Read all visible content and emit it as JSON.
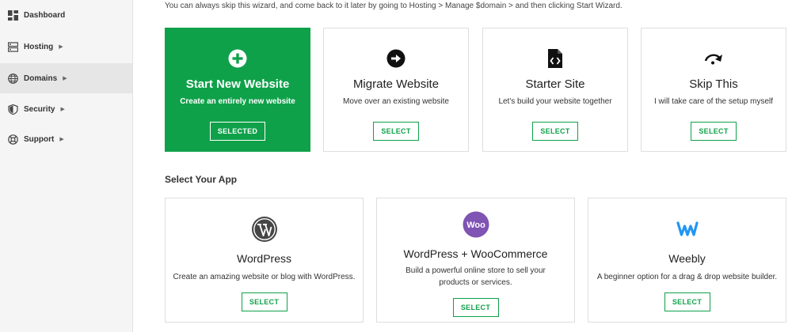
{
  "sidebar": {
    "items": [
      {
        "label": "Dashboard",
        "icon": "dashboard-icon",
        "has_chevron": false
      },
      {
        "label": "Hosting",
        "icon": "server-icon",
        "has_chevron": true
      },
      {
        "label": "Domains",
        "icon": "globe-icon",
        "has_chevron": true
      },
      {
        "label": "Security",
        "icon": "shield-icon",
        "has_chevron": true
      },
      {
        "label": "Support",
        "icon": "lifebuoy-icon",
        "has_chevron": true
      }
    ],
    "active_index": 2
  },
  "header": {
    "hint": "You can always skip this wizard, and come back to it later by going to Hosting > Manage $domain > and then clicking Start Wizard."
  },
  "options": [
    {
      "title": "Start New Website",
      "subtitle": "Create an entirely new website",
      "button": "SELECTED",
      "selected": true,
      "icon": "plus-circle-icon"
    },
    {
      "title": "Migrate Website",
      "subtitle": "Move over an existing website",
      "button": "SELECT",
      "selected": false,
      "icon": "arrow-right-circle-icon"
    },
    {
      "title": "Starter Site",
      "subtitle": "Let's build your website together",
      "button": "SELECT",
      "selected": false,
      "icon": "file-code-icon"
    },
    {
      "title": "Skip This",
      "subtitle": "I will take care of the setup myself",
      "button": "SELECT",
      "selected": false,
      "icon": "redo-arrow-icon"
    }
  ],
  "apps_section": {
    "title": "Select Your App",
    "apps": [
      {
        "title": "WordPress",
        "subtitle": "Create an amazing website or blog with WordPress.",
        "button": "SELECT",
        "icon": "wordpress-icon"
      },
      {
        "title": "WordPress + WooCommerce",
        "subtitle": "Build a powerful online store to sell your products or services.",
        "button": "SELECT",
        "icon": "woocommerce-icon",
        "icon_text": "Woo"
      },
      {
        "title": "Weebly",
        "subtitle": "A beginner option for a drag & drop website builder.",
        "button": "SELECT",
        "icon": "weebly-icon"
      }
    ]
  },
  "colors": {
    "accent": "#0fa14a",
    "woo": "#7f54b3",
    "weebly": "#2196f3"
  }
}
